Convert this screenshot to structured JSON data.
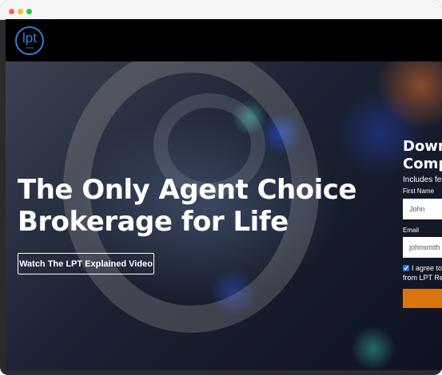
{
  "hero": {
    "headline": "The Only Agent Choice Brokerage for Life",
    "video_button": "Watch The LPT Explained Video"
  },
  "logo": {
    "text": "lpt",
    "subtext": "realty"
  },
  "form": {
    "title": "Dow Comp",
    "subtitle": "Includes fee",
    "first_name_label": "First Name",
    "first_name_value": "John",
    "email_label": "Email",
    "email_value": "johnsmith",
    "agree_line1": "I agree to",
    "agree_line2": "from LPT Re",
    "checkbox_checked": true,
    "submit_color": "#d9760f"
  },
  "colors": {
    "brand_blue": "#3b7bd8",
    "nav_bg": "#000000"
  }
}
